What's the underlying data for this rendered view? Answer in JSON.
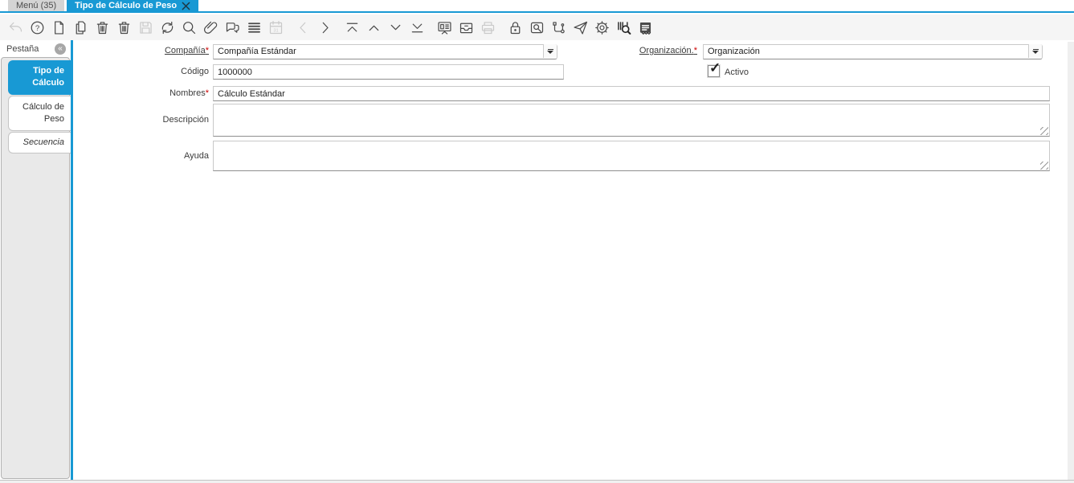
{
  "window": {
    "tabs": [
      {
        "label": "Menú (35)",
        "active": false
      },
      {
        "label": "Tipo de Cálculo de Peso",
        "active": true,
        "closable": true
      }
    ]
  },
  "toolbar": {
    "icons": [
      {
        "name": "undo-icon",
        "disabled": true
      },
      {
        "name": "help-icon"
      },
      {
        "name": "new-record-icon"
      },
      {
        "name": "copy-record-icon"
      },
      {
        "name": "delete-record-icon"
      },
      {
        "name": "delete-selection-icon"
      },
      {
        "name": "save-icon",
        "disabled": true
      },
      {
        "name": "refresh-icon"
      },
      {
        "name": "find-icon"
      },
      {
        "name": "attachment-icon"
      },
      {
        "name": "chat-icon"
      },
      {
        "name": "grid-toggle-icon"
      },
      {
        "name": "calendar-icon",
        "disabled": true
      },
      {
        "name": "parent-record-icon",
        "disabled": true,
        "group": true
      },
      {
        "name": "detail-record-icon"
      },
      {
        "name": "first-record-icon",
        "group": true
      },
      {
        "name": "previous-record-icon"
      },
      {
        "name": "next-record-icon"
      },
      {
        "name": "last-record-icon"
      },
      {
        "name": "performance-icon",
        "group": true
      },
      {
        "name": "archive-icon"
      },
      {
        "name": "print-icon",
        "disabled": true
      },
      {
        "name": "private-record-lock-icon",
        "group": true
      },
      {
        "name": "zoom-across-icon"
      },
      {
        "name": "workflow-icon"
      },
      {
        "name": "request-icon"
      },
      {
        "name": "preference-icon"
      },
      {
        "name": "product-info-icon",
        "dark": true
      },
      {
        "name": "report-icon",
        "dark": true
      }
    ]
  },
  "sidebar": {
    "header": "Pestaña",
    "collapse_glyph": "«",
    "tabs": [
      {
        "label": "Tipo de Cálculo",
        "active": true
      },
      {
        "label": "Cálculo de Peso",
        "active": false
      },
      {
        "label": "Secuencia",
        "active": false,
        "italic": true
      }
    ]
  },
  "form": {
    "company": {
      "label": "Compañía",
      "required": "*",
      "value": "Compañía Estándar"
    },
    "organization": {
      "label": "Organización.",
      "required": "*",
      "value": "Organización"
    },
    "code": {
      "label": "Código",
      "value": "1000000"
    },
    "active": {
      "label": "Activo",
      "checked": true,
      "check_glyph": "✓"
    },
    "names": {
      "label": "Nombres",
      "required": "*",
      "value": "Cálculo Estándar"
    },
    "description": {
      "label": "Descripción",
      "value": ""
    },
    "help": {
      "label": "Ayuda",
      "value": ""
    }
  },
  "colors": {
    "accent_blue": "#1899d4",
    "inactive_tab_bg": "#d4d4d4",
    "toolbar_bg": "#f5f5f5",
    "sidebar_panel_bg": "#e9e9e9",
    "required_red": "#cc0000"
  }
}
